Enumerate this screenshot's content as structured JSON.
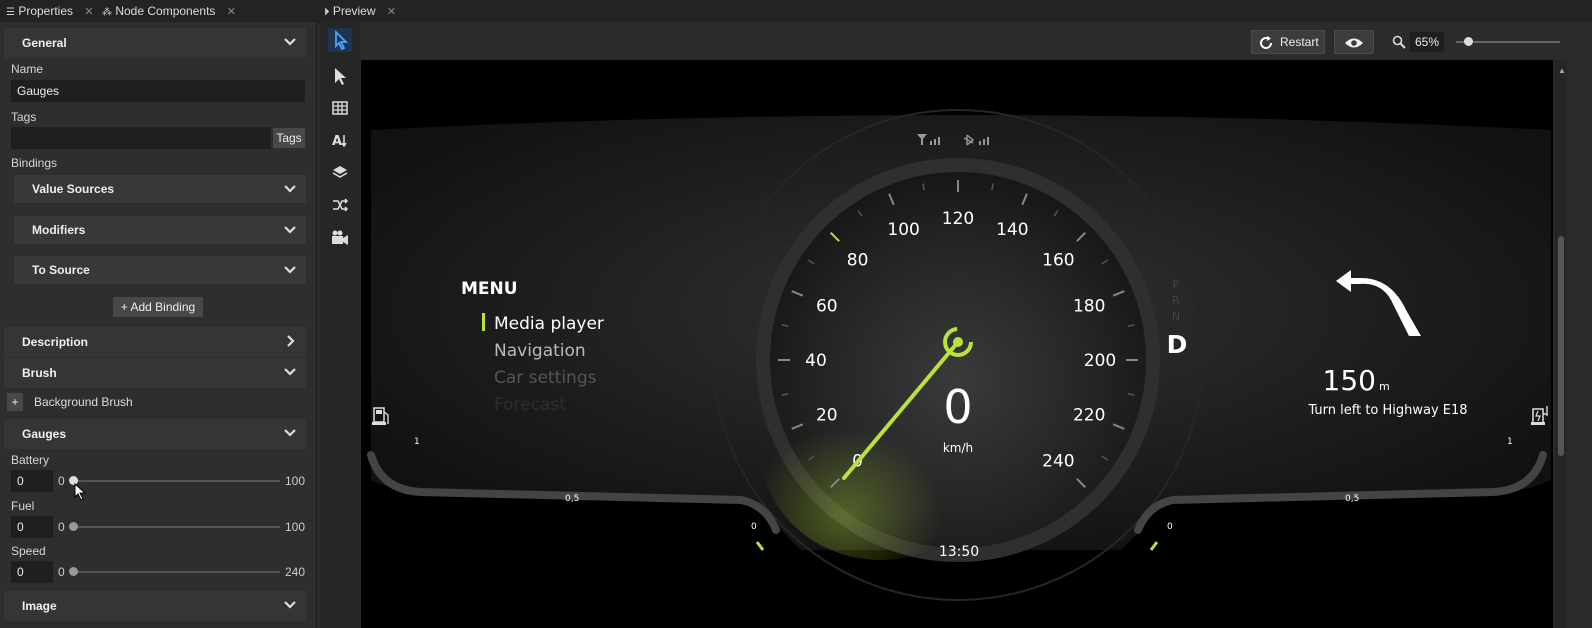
{
  "tabs": {
    "properties": "Properties",
    "node_components": "Node Components",
    "preview": "Preview"
  },
  "properties": {
    "general": {
      "title": "General"
    },
    "name": {
      "label": "Name",
      "value": "Gauges"
    },
    "tags": {
      "label": "Tags",
      "value": "",
      "button": "Tags"
    },
    "bindings": {
      "label": "Bindings",
      "value_sources": "Value Sources",
      "modifiers": "Modifiers",
      "to_source": "To Source",
      "add_binding": "+ Add Binding"
    },
    "description": {
      "title": "Description"
    },
    "brush": {
      "title": "Brush",
      "background_brush": "Background Brush",
      "add": "+"
    },
    "gauges": {
      "title": "Gauges",
      "battery": {
        "label": "Battery",
        "value": "0",
        "min": "0",
        "max": "100"
      },
      "fuel": {
        "label": "Fuel",
        "value": "0",
        "min": "0",
        "max": "100"
      },
      "speed": {
        "label": "Speed",
        "value": "0",
        "min": "0",
        "max": "240"
      }
    },
    "image": {
      "title": "Image"
    }
  },
  "toolbar": {
    "tools": [
      "pointer-select-icon",
      "select-arrow-icon",
      "grid-icon",
      "text-sort-icon",
      "layers-icon",
      "shuffle-icon",
      "camera-icon"
    ]
  },
  "preview": {
    "restart": "Restart",
    "zoom": "65%",
    "zoom_level": 0.08
  },
  "dashboard": {
    "menu_title": "MENU",
    "menu_items": [
      "Media player",
      "Navigation",
      "Car settings",
      "Forecast"
    ],
    "speed_value": "0",
    "speed_unit": "km/h",
    "speed_ticks": [
      "0",
      "20",
      "40",
      "60",
      "80",
      "100",
      "120",
      "140",
      "160",
      "180",
      "200",
      "220",
      "240"
    ],
    "gear_letters": [
      "P",
      "R",
      "N"
    ],
    "gear": "D",
    "distance_value": "150",
    "distance_unit": "m",
    "instruction": "Turn left to Highway E18",
    "clock": "13:50",
    "left_gauge": {
      "top": "1",
      "mid": "0,5",
      "bottom": "0"
    },
    "right_gauge": {
      "top": "1",
      "mid": "0,5",
      "bottom": "0"
    },
    "accent_color": "#b9e23a"
  }
}
